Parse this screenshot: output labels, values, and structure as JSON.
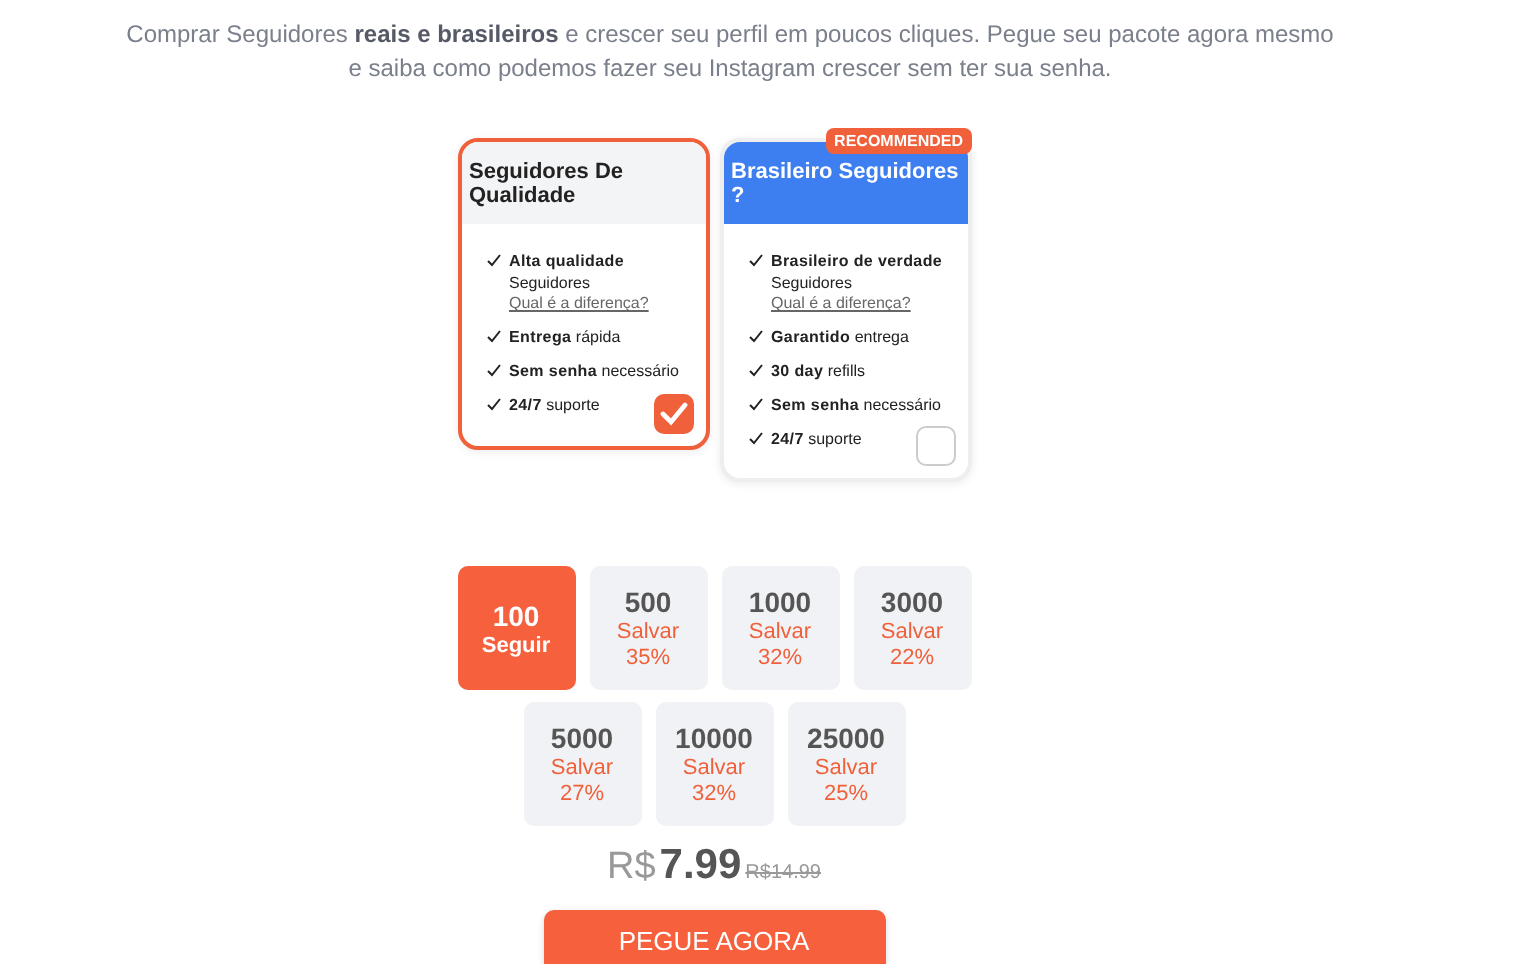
{
  "intro": "Comprar Seguidores **reais e brasileiros** e crescer seu perfil em poucos cliques. Pegue seu pacote agora mesmo e saiba como podemos fazer seu Instagram crescer sem ter sua senha.",
  "plans": [
    {
      "title": "Seguidores De Qualidade",
      "selected": true,
      "features": [
        {
          "text": "**Alta qualidade** Seguidores",
          "link": "Qual é a diferença?"
        },
        {
          "text": "**Entrega** rápida"
        },
        {
          "text": "**Sem senha** necessário"
        },
        {
          "text": "**24/7** suporte"
        }
      ]
    },
    {
      "title": "Brasileiro Seguidores ?",
      "badge": "RECOMMENDED",
      "selected": false,
      "features": [
        {
          "text": "**Brasileiro de verdade** Seguidores",
          "link": "Qual é a diferença?"
        },
        {
          "text": "**Garantido** entrega"
        },
        {
          "text": "**30 day** refills"
        },
        {
          "text": "**Sem senha** necessário"
        },
        {
          "text": "**24/7** suporte"
        }
      ]
    }
  ],
  "packages": [
    {
      "amount": "100",
      "label": "Seguir",
      "selected": true
    },
    {
      "amount": "500",
      "label": "Salvar",
      "discount": "35%",
      "selected": false
    },
    {
      "amount": "1000",
      "label": "Salvar",
      "discount": "32%",
      "selected": false
    },
    {
      "amount": "3000",
      "label": "Salvar",
      "discount": "22%",
      "selected": false
    },
    {
      "amount": "5000",
      "label": "Salvar",
      "discount": "27%",
      "selected": false
    },
    {
      "amount": "10000",
      "label": "Salvar",
      "discount": "32%",
      "selected": false
    },
    {
      "amount": "25000",
      "label": "Salvar",
      "discount": "25%",
      "selected": false
    }
  ],
  "price": {
    "currency": "R$",
    "amount": "7.99",
    "old": "R$14.99"
  },
  "cta": "PEGUE AGORA"
}
